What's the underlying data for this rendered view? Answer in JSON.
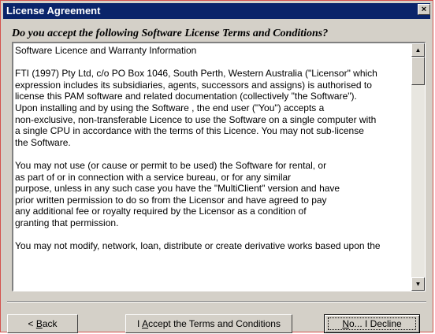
{
  "window": {
    "title": "License Agreement",
    "close_glyph": "×"
  },
  "heading": "Do you accept the following Software License Terms and Conditions?",
  "license": {
    "paragraphs": [
      "Software Licence and Warranty Information",
      "FTI (1997) Pty Ltd, c/o PO Box 1046, South Perth, Western Australia (\"Licensor\" which\nexpression includes its subsidiaries, agents, successors and assigns) is authorised to\nlicense this PAM software and related documentation (collectively \"the Software\").\nUpon installing and by using the Software , the end user (\"You\") accepts a\nnon-exclusive, non-transferable Licence to use the Software on a single computer with\na single CPU in accordance with the terms of this Licence.  You may not sub-license\nthe Software.",
      "You may not use (or cause or permit to be used) the Software for rental, or\nas part of or in connection with a service bureau, or for any similar\npurpose, unless in any such case you have the \"MultiClient\" version and have\nprior written permission to do so from the Licensor and have agreed to pay\nany additional fee or royalty required by the Licensor as a condition of\ngranting that permission.",
      "You may not modify, network, loan, distribute or create derivative works based upon the"
    ]
  },
  "buttons": {
    "back": {
      "prefix": "< ",
      "hotkey": "B",
      "rest": "ack"
    },
    "accept": {
      "prefix": "I ",
      "hotkey": "A",
      "rest": "ccept the Terms and Conditions"
    },
    "decline": {
      "hotkey": "N",
      "rest": "o... I Decline"
    }
  },
  "scrollbar": {
    "up_glyph": "▲",
    "down_glyph": "▼",
    "position_fraction": 0.0
  },
  "colors": {
    "titlebar": "#0a246a",
    "face": "#d4d0c8",
    "window_border": "#d4524d"
  }
}
